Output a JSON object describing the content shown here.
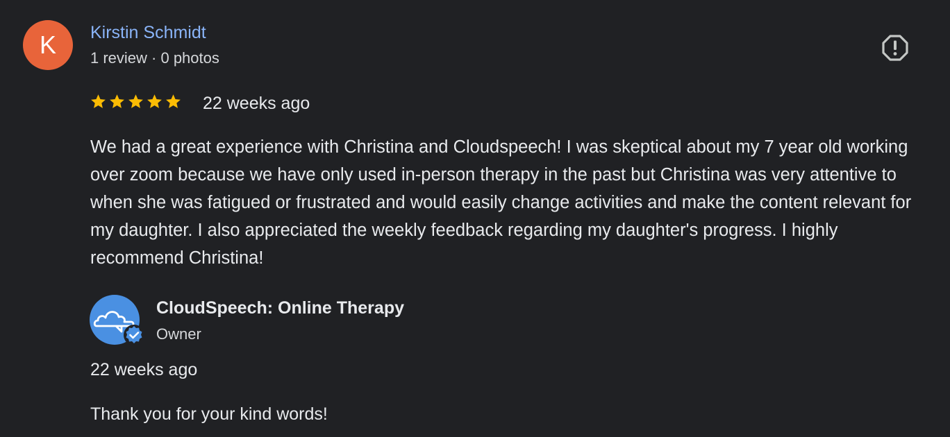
{
  "review": {
    "avatar_initial": "K",
    "avatar_color": "#e8643a",
    "reviewer_name": "Kirstin Schmidt",
    "reviewer_meta": "1 review · 0 photos",
    "rating": 5,
    "rating_max": 5,
    "star_color": "#fbbc04",
    "time": "22 weeks ago",
    "text": "We had a great experience with Christina and Cloudspeech! I was skeptical about my 7 year old working over zoom because we have only used in-person therapy in the past but Christina was very attentive to when she was fatigued or frustrated and would easily change activities and make the content relevant for my daughter. I also appreciated the weekly feedback regarding my daughter's progress. I highly recommend Christina!",
    "flag_icon": "report-flag-icon"
  },
  "owner_reply": {
    "avatar_icon": "cloud-logo-icon",
    "verified_icon": "verified-badge-icon",
    "owner_name": "CloudSpeech: Online Therapy",
    "owner_role": "Owner",
    "time": "22 weeks ago",
    "text": "Thank you for your kind words!"
  },
  "colors": {
    "background": "#202124",
    "link": "#8ab4f8",
    "owner_avatar": "#4285f4"
  }
}
